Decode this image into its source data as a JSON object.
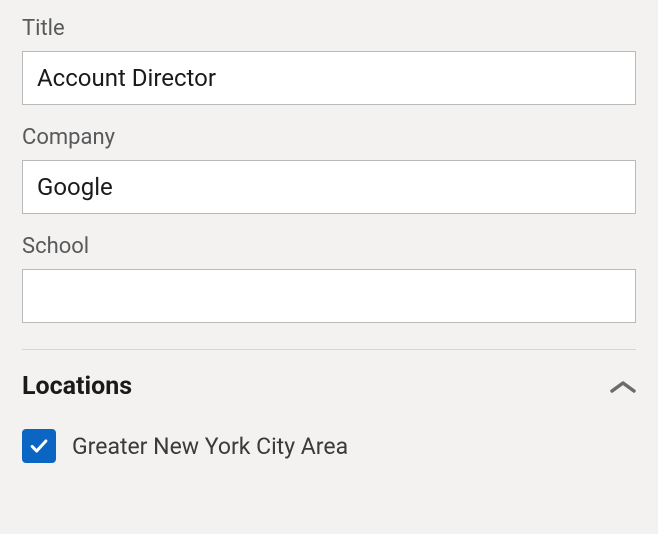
{
  "fields": {
    "title": {
      "label": "Title",
      "value": "Account Director"
    },
    "company": {
      "label": "Company",
      "value": "Google"
    },
    "school": {
      "label": "School",
      "value": ""
    }
  },
  "locations": {
    "heading": "Locations",
    "items": [
      {
        "label": "Greater New York City Area",
        "checked": true
      }
    ]
  }
}
